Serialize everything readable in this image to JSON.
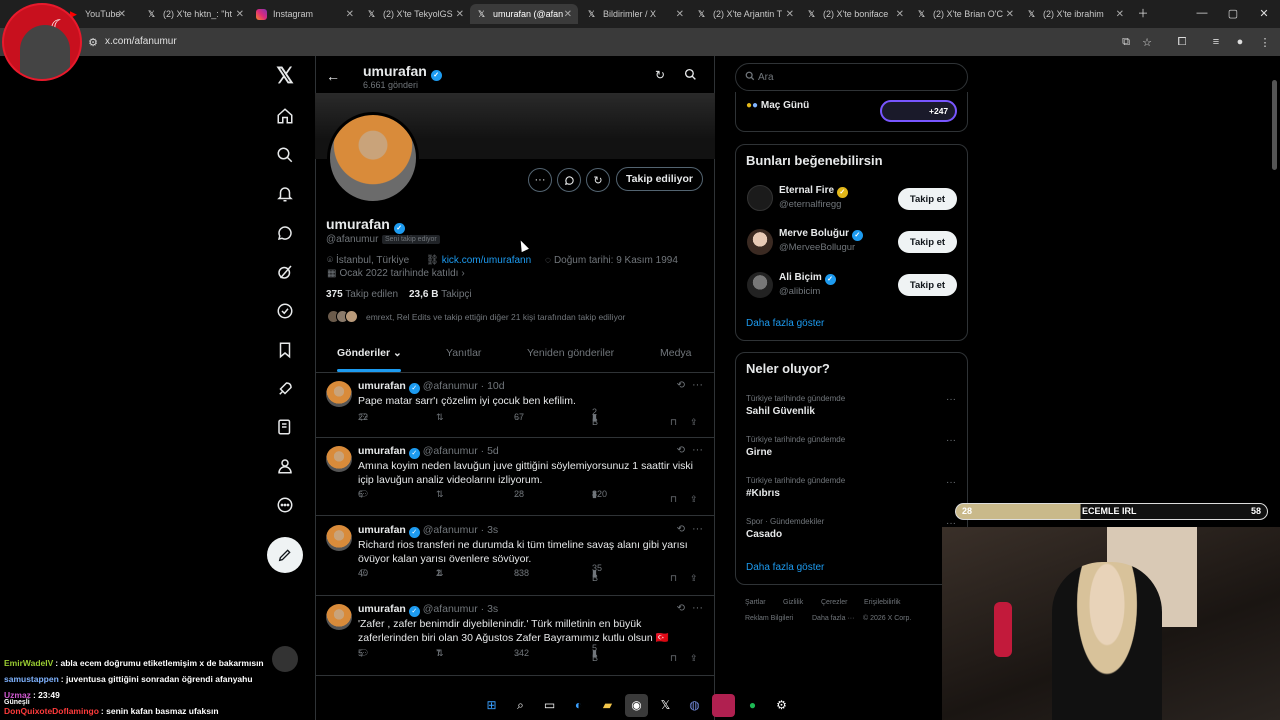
{
  "browser": {
    "tabs": [
      {
        "label": "YouTube",
        "icon": "youtube-icon"
      },
      {
        "label": "(2) X'te hktn_: \"ht",
        "icon": "x-icon"
      },
      {
        "label": "Instagram",
        "icon": "instagram-icon"
      },
      {
        "label": "(2) X'te TekyolGS",
        "icon": "x-icon"
      },
      {
        "label": "umurafan (@afan",
        "icon": "x-icon"
      },
      {
        "label": "Bildirimler / X",
        "icon": "x-icon"
      },
      {
        "label": "(2) X'te Arjantin T",
        "icon": "x-icon"
      },
      {
        "label": "(2) X'te boniface",
        "icon": "x-icon"
      },
      {
        "label": "(2) X'te Brian O'C",
        "icon": "x-icon"
      },
      {
        "label": "(2) X'te ibrahim",
        "icon": "x-icon"
      }
    ],
    "active_tab": 4,
    "url": "x.com/afanumur"
  },
  "header": {
    "name": "umurafan",
    "post_count": "6.661 gönderi"
  },
  "profile": {
    "name": "umurafan",
    "handle": "@afanumur",
    "follows_you": "Seni takip ediyor",
    "location": "İstanbul, Türkiye",
    "website": "kick.com/umurafann",
    "birthday": "Doğum tarihi: 9 Kasım 1994",
    "joined": "Ocak 2022 tarihinde katıldı",
    "following_count": "375",
    "following_label": "Takip edilen",
    "followers_count": "23,6 B",
    "followers_label": "Takipçi",
    "followers_note": "emrext, Rel Edits ve takip ettiğin diğer 21 kişi tarafından takip ediliyor",
    "follow_button": "Takip ediliyor"
  },
  "profile_tabs": [
    "Gönderiler",
    "Yanıtlar",
    "Yeniden gönderiler",
    "Medya"
  ],
  "tweets": [
    {
      "name": "umurafan",
      "handle": "@afanumur",
      "time": "10d",
      "text": "Pape matar sarr'ı çözelim iyi çocuk ben kefilim.",
      "replies": "22",
      "retweets": "",
      "likes": "67",
      "views": "2 B"
    },
    {
      "name": "umurafan",
      "handle": "@afanumur",
      "time": "5d",
      "text": "Amına koyim neden lavuğun juve gittiğini söylemiyorsunuz 1 saattir viski içip lavuğun analiz videolarını izliyorum.",
      "replies": "6",
      "retweets": "",
      "likes": "28",
      "views": "820"
    },
    {
      "name": "umurafan",
      "handle": "@afanumur",
      "time": "3s",
      "text": "Richard rios transferi ne durumda ki tüm timeline savaş alanı gibi yarısı övüyor kalan yarısı övenlere sövüyor.",
      "replies": "40",
      "retweets": "2",
      "likes": "838",
      "views": "35 B"
    },
    {
      "name": "umurafan",
      "handle": "@afanumur",
      "time": "3s",
      "text": "'Zafer , zafer benimdir diyebilenindir.' Türk milletinin en büyük zaferlerinden biri olan 30 Ağustos Zafer Bayramımız kutlu olsun 🇹🇷",
      "replies": "5",
      "retweets": "7",
      "likes": "342",
      "views": "5 B"
    }
  ],
  "sidebar": {
    "search_placeholder": "Ara",
    "live_label": "Maç Günü",
    "live_count": "+247",
    "suggestions_title": "Bunları beğenebilirsin",
    "suggestions": [
      {
        "name": "Eternal Fire",
        "handle": "@eternalfiregg",
        "button": "Takip et",
        "badge": "gold"
      },
      {
        "name": "Merve Boluğur",
        "handle": "@MerveeBollugur",
        "button": "Takip et",
        "badge": "blue"
      },
      {
        "name": "Ali Biçim",
        "handle": "@alibicim",
        "button": "Takip et",
        "badge": "blue"
      }
    ],
    "show_more": "Daha fazla göster",
    "trends_title": "Neler oluyor?",
    "trends": [
      {
        "context": "Türkiye tarihinde gündemde",
        "name": "Sahil Güvenlik"
      },
      {
        "context": "Türkiye tarihinde gündemde",
        "name": "Girne"
      },
      {
        "context": "Türkiye tarihinde gündemde",
        "name": "#Kıbrıs"
      },
      {
        "context": "Spor · Gündemdekiler",
        "name": "Casado"
      }
    ],
    "trends_show_more": "Daha fazla göster",
    "footer": [
      "Şartlar",
      "Gizlilik",
      "Çerezler",
      "Erişilebilirlik",
      "Reklam Bilgileri",
      "Daha fazla ···",
      "© 2026 X Corp."
    ]
  },
  "stream": {
    "bar_left": "28",
    "bar_title": "ECEMLE IRL",
    "bar_right": "58",
    "chat": [
      {
        "user": "EmirWadeIV",
        "text": ": abla ecem doğrumu etiketlemişim x de bakarmısın",
        "color": "#9acd32"
      },
      {
        "user": "samustappen",
        "text": ": juventusa gittiğini sonradan öğrendi afanyahu",
        "color": "#7fb3ff"
      },
      {
        "user": "Uzmaz",
        "text": ": 23:49",
        "color": "#d35ad3"
      },
      {
        "user": "Güneşli",
        "text": "",
        "color": "#ffffff"
      },
      {
        "user": "DonQuixoteDoflamingo",
        "text": ": senin kafan basmaz ufaksın",
        "color": "#ff3b3b"
      }
    ]
  },
  "colors": {
    "accent": "#1d9bf0",
    "background": "#000000",
    "border": "#2f3336",
    "muted": "#71767b"
  }
}
